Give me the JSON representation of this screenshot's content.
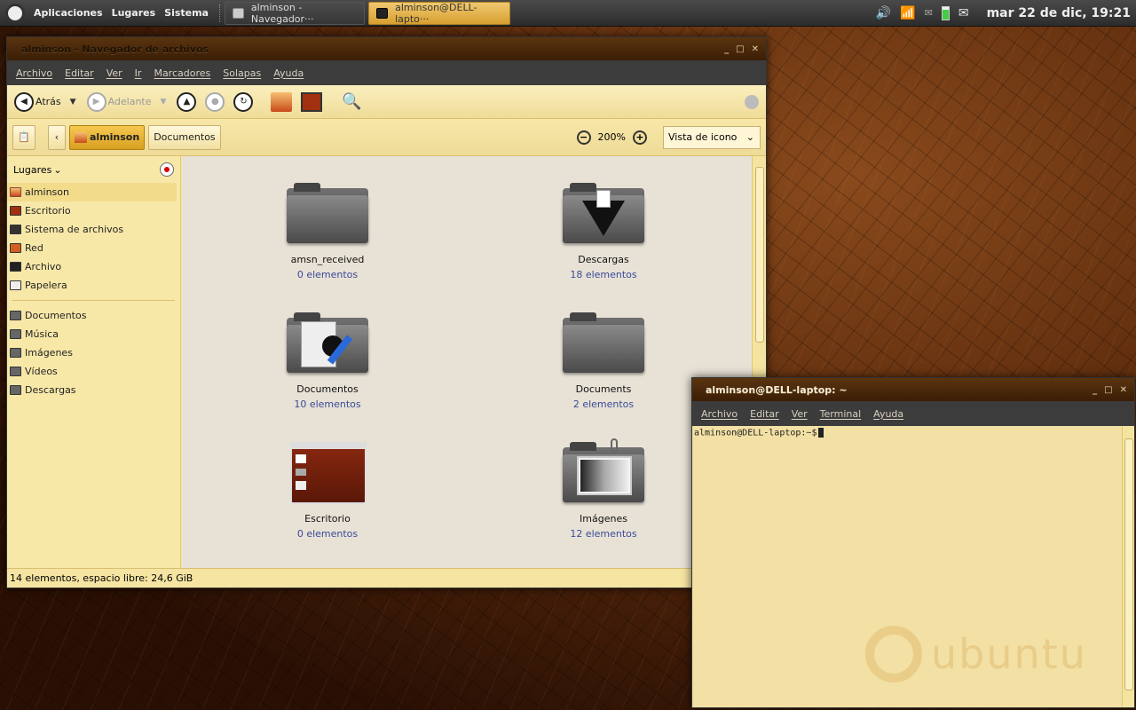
{
  "panel": {
    "menus": [
      "Aplicaciones",
      "Lugares",
      "Sistema"
    ],
    "tasks": [
      {
        "label": "alminson - Navegador···",
        "active": false
      },
      {
        "label": "alminson@DELL-lapto···",
        "active": true
      }
    ],
    "clock": "mar 22 de dic, 19:21",
    "tray_icons": [
      "volume-icon",
      "wifi-icon",
      "mail-indicator-icon",
      "battery-icon",
      "envelope-icon"
    ]
  },
  "filemanager": {
    "title": "alminson - Navegador de archivos",
    "menu": [
      "Archivo",
      "Editar",
      "Ver",
      "Ir",
      "Marcadores",
      "Solapas",
      "Ayuda"
    ],
    "toolbar": {
      "back": "Atrás",
      "forward": "Adelante"
    },
    "location": {
      "crumbs": [
        "alminson",
        "Documentos"
      ],
      "zoom": "200%",
      "view": "Vista de icono"
    },
    "sidebar": {
      "header": "Lugares",
      "places": [
        "alminson",
        "Escritorio",
        "Sistema de archivos",
        "Red",
        "Archivo",
        "Papelera"
      ],
      "bookmarks": [
        "Documentos",
        "Música",
        "Imágenes",
        "Vídeos",
        "Descargas"
      ]
    },
    "items": [
      {
        "name": "amsn_received",
        "count": "0 elementos"
      },
      {
        "name": "Descargas",
        "count": "18 elementos"
      },
      {
        "name": "Documentos",
        "count": "10 elementos"
      },
      {
        "name": "Documents",
        "count": "2 elementos"
      },
      {
        "name": "Escritorio",
        "count": "0 elementos"
      },
      {
        "name": "Imágenes",
        "count": "12 elementos"
      }
    ],
    "status": "14 elementos, espacio libre: 24,6 GiB"
  },
  "terminal": {
    "title": "alminson@DELL-laptop: ~",
    "menu": [
      "Archivo",
      "Editar",
      "Ver",
      "Terminal",
      "Ayuda"
    ],
    "prompt": "alminson@DELL-laptop:~$",
    "watermark": "ubuntu"
  },
  "colors": {
    "accent": "#e8b040",
    "link": "#3a4a98"
  }
}
